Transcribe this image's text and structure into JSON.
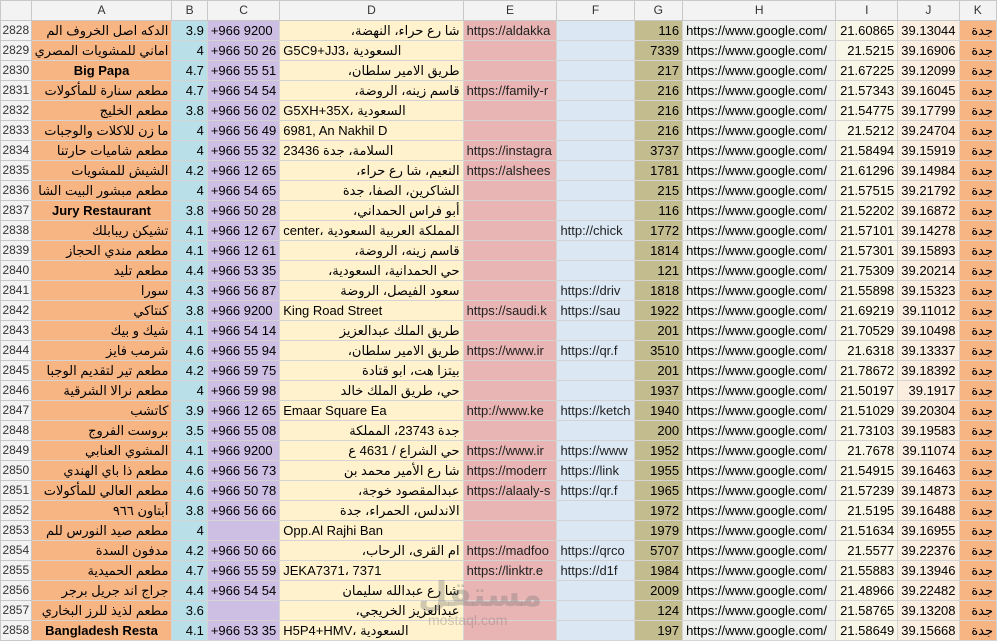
{
  "columns": [
    "A",
    "B",
    "C",
    "D",
    "E",
    "F",
    "G",
    "H",
    "I",
    "J",
    "K"
  ],
  "rows": [
    {
      "n": "2828",
      "A": "الدكه اصل الخروف الم",
      "B": "3.9",
      "C": "+966 9200",
      "D": "شا رع حراء، النهضة،",
      "E": "https://aldakka",
      "F": "",
      "G": "116",
      "H": "https://www.google.com/",
      "I": "21.60865",
      "J": "39.13044",
      "K": "جدة"
    },
    {
      "n": "2829",
      "A": "اماني للمشويات المصري",
      "B": "4",
      "C": "+966 50 26",
      "D": "G5C9+JJ3، السعودية",
      "E": "",
      "F": "",
      "G": "7339",
      "H": "https://www.google.com/",
      "I": "21.5215",
      "J": "39.16906",
      "K": "جدة"
    },
    {
      "n": "2830",
      "A": "Big Papa",
      "B": "4.7",
      "C": "+966 55 51",
      "D": "طريق الامير سلطان،",
      "E": "",
      "F": "",
      "G": "217",
      "H": "https://www.google.com/",
      "I": "21.67225",
      "J": "39.12099",
      "K": "جدة"
    },
    {
      "n": "2831",
      "A": "مطعم سنارة للمأكولات",
      "B": "4.7",
      "C": "+966 54 54",
      "D": "قاسم زينه، الروضة،",
      "E": "https://family-r",
      "F": "",
      "G": "216",
      "H": "https://www.google.com/",
      "I": "21.57343",
      "J": "39.16045",
      "K": "جدة"
    },
    {
      "n": "2832",
      "A": "مطعم الخليج",
      "B": "3.8",
      "C": "+966 56 02",
      "D": "G5XH+35X، السعودية",
      "E": "",
      "F": "",
      "G": "216",
      "H": "https://www.google.com/",
      "I": "21.54775",
      "J": "39.17799",
      "K": "جدة"
    },
    {
      "n": "2833",
      "A": "ما زن للاكلات والوجبات",
      "B": "4",
      "C": "+966 56 49",
      "D": "6981, An Nakhil D",
      "E": "",
      "F": "",
      "G": "216",
      "H": "https://www.google.com/",
      "I": "21.5212",
      "J": "39.24704",
      "K": "جدة"
    },
    {
      "n": "2834",
      "A": "مطعم شاميات حارتنا",
      "B": "4",
      "C": "+966 55 32",
      "D": "23436 السلامة، جدة",
      "E": "https://instagra",
      "F": "",
      "G": "3737",
      "H": "https://www.google.com/",
      "I": "21.58494",
      "J": "39.15919",
      "K": "جدة"
    },
    {
      "n": "2835",
      "A": "الشيش للمشويات",
      "B": "4.2",
      "C": "+966 12 65",
      "D": "النعيم، شا رع حراء،",
      "E": "https://alshees",
      "F": "",
      "G": "1781",
      "H": "https://www.google.com/",
      "I": "21.61296",
      "J": "39.14984",
      "K": "جدة"
    },
    {
      "n": "2836",
      "A": "مطعم مبشور البيت الشا",
      "B": "4",
      "C": "+966 54 65",
      "D": "الشاكرين، الصفا، جدة",
      "E": "",
      "F": "",
      "G": "215",
      "H": "https://www.google.com/",
      "I": "21.57515",
      "J": "39.21792",
      "K": "جدة"
    },
    {
      "n": "2837",
      "A": "Jury Restaurant",
      "B": "3.8",
      "C": "+966 50 28",
      "D": "أبو فراس الحمداني،",
      "E": "",
      "F": "",
      "G": "116",
      "H": "https://www.google.com/",
      "I": "21.52202",
      "J": "39.16872",
      "K": "جدة"
    },
    {
      "n": "2838",
      "A": "تشيكن ريبابلك",
      "B": "4.1",
      "C": "+966 12 67",
      "D": "center، المملكة العربية السعودية",
      "E": "",
      "F": "http://chick",
      "G": "1772",
      "H": "https://www.google.com/",
      "I": "21.57101",
      "J": "39.14278",
      "K": "جدة"
    },
    {
      "n": "2839",
      "A": "مطعم مندي الحجاز",
      "B": "4.1",
      "C": "+966 12 61",
      "D": "قاسم زينه، الروضة،",
      "E": "",
      "F": "",
      "G": "1814",
      "H": "https://www.google.com/",
      "I": "21.57301",
      "J": "39.15893",
      "K": "جدة"
    },
    {
      "n": "2840",
      "A": "مطعم تليد",
      "B": "4.4",
      "C": "+966 53 35",
      "D": "حي الحمدانية، السعودية،",
      "E": "",
      "F": "",
      "G": "121",
      "H": "https://www.google.com/",
      "I": "21.75309",
      "J": "39.20214",
      "K": "جدة"
    },
    {
      "n": "2841",
      "A": "سورا",
      "B": "4.3",
      "C": "+966 56 87",
      "D": "سعود الفيصل، الروضة",
      "E": "",
      "F": "https://driv",
      "G": "1818",
      "H": "https://www.google.com/",
      "I": "21.55898",
      "J": "39.15323",
      "K": "جدة"
    },
    {
      "n": "2842",
      "A": "كنتاكي",
      "B": "3.8",
      "C": "+966 9200",
      "D": "King Road Street",
      "E": "https://saudi.k",
      "F": "https://sau",
      "G": "1922",
      "H": "https://www.google.com/",
      "I": "21.69219",
      "J": "39.11012",
      "K": "جدة"
    },
    {
      "n": "2843",
      "A": "شيك و بيك",
      "B": "4.1",
      "C": "+966 54 14",
      "D": "طريق الملك عبدالعزيز",
      "E": "",
      "F": "",
      "G": "201",
      "H": "https://www.google.com/",
      "I": "21.70529",
      "J": "39.10498",
      "K": "جدة"
    },
    {
      "n": "2844",
      "A": "شرمب فايز",
      "B": "4.6",
      "C": "+966 55 94",
      "D": "طريق الامير سلطان،",
      "E": "https://www.ir",
      "F": "https://qr.f",
      "G": "3510",
      "H": "https://www.google.com/",
      "I": "21.6318",
      "J": "39.13337",
      "K": "جدة"
    },
    {
      "n": "2845",
      "A": "مطعم تير لتقديم الوجبا",
      "B": "4.2",
      "C": "+966 59 75",
      "D": "بيتزا هت، ابو قتادة",
      "E": "",
      "F": "",
      "G": "201",
      "H": "https://www.google.com/",
      "I": "21.78672",
      "J": "39.18392",
      "K": "جدة"
    },
    {
      "n": "2846",
      "A": "مطعم نرالا الشرقية",
      "B": "4",
      "C": "+966 59 98",
      "D": "حي، طريق الملك خالد",
      "E": "",
      "F": "",
      "G": "1937",
      "H": "https://www.google.com/",
      "I": "21.50197",
      "J": "39.1917",
      "K": "جدة"
    },
    {
      "n": "2847",
      "A": "كاتشب",
      "B": "3.9",
      "C": "+966 12 65",
      "D": "Emaar Square Ea",
      "E": "http://www.ke",
      "F": "https://ketch",
      "G": "1940",
      "H": "https://www.google.com/",
      "I": "21.51029",
      "J": "39.20304",
      "K": "جدة"
    },
    {
      "n": "2848",
      "A": "بروست الفروج",
      "B": "3.5",
      "C": "+966 55 08",
      "D": "جدة 23743، المملكة",
      "E": "",
      "F": "",
      "G": "200",
      "H": "https://www.google.com/",
      "I": "21.73103",
      "J": "39.19583",
      "K": "جدة"
    },
    {
      "n": "2849",
      "A": "المشوي العنابي",
      "B": "4.1",
      "C": "+966 9200",
      "D": "حي الشراع / 4631 ع",
      "E": "https://www.ir",
      "F": "https://www",
      "G": "1952",
      "H": "https://www.google.com/",
      "I": "21.7678",
      "J": "39.11074",
      "K": "جدة"
    },
    {
      "n": "2850",
      "A": "مطعم ذا باي الهندي",
      "B": "4.6",
      "C": "+966 56 73",
      "D": "شا رع الأمير محمد بن",
      "E": "https://moderr",
      "F": "https://link",
      "G": "1955",
      "H": "https://www.google.com/",
      "I": "21.54915",
      "J": "39.16463",
      "K": "جدة"
    },
    {
      "n": "2851",
      "A": "مطعم العالي للمأكولات",
      "B": "4.6",
      "C": "+966 50 78",
      "D": "عبدالمقصود خوجة،",
      "E": "https://alaaly-s",
      "F": "https://qr.f",
      "G": "1965",
      "H": "https://www.google.com/",
      "I": "21.57239",
      "J": "39.14873",
      "K": "جدة"
    },
    {
      "n": "2852",
      "A": "أبتاون ٩٦٦",
      "B": "3.8",
      "C": "+966 56 66",
      "D": "الاندلس، الحمراء، جدة",
      "E": "",
      "F": "",
      "G": "1972",
      "H": "https://www.google.com/",
      "I": "21.5195",
      "J": "39.16488",
      "K": "جدة"
    },
    {
      "n": "2853",
      "A": "مطعم صيد النورس للم",
      "B": "4",
      "C": "",
      "D": "Opp.Al Rajhi Ban",
      "E": "",
      "F": "",
      "G": "1979",
      "H": "https://www.google.com/",
      "I": "21.51634",
      "J": "39.16955",
      "K": "جدة"
    },
    {
      "n": "2854",
      "A": "مدفون السدة",
      "B": "4.2",
      "C": "+966 50 66",
      "D": "ام القرى، الرحاب،",
      "E": "https://madfoo",
      "F": "https://qrco",
      "G": "5707",
      "H": "https://www.google.com/",
      "I": "21.5577",
      "J": "39.22376",
      "K": "جدة"
    },
    {
      "n": "2855",
      "A": "مطعم الحميدية",
      "B": "4.7",
      "C": "+966 55 59",
      "D": "JEKA7371، 7371",
      "E": "https://linktr.e",
      "F": "https://d1f",
      "G": "1984",
      "H": "https://www.google.com/",
      "I": "21.55883",
      "J": "39.13946",
      "K": "جدة"
    },
    {
      "n": "2856",
      "A": "جراج اند جريل برجر",
      "B": "4.4",
      "C": "+966 54 54",
      "D": "شا رع عبدالله سليمان",
      "E": "",
      "F": "",
      "G": "2009",
      "H": "https://www.google.com/",
      "I": "21.48966",
      "J": "39.22482",
      "K": "جدة"
    },
    {
      "n": "2857",
      "A": "مطعم لذيذ للرز البخاري",
      "B": "3.6",
      "C": "",
      "D": "عبدالعزيز الخريجي،",
      "E": "",
      "F": "",
      "G": "124",
      "H": "https://www.google.com/",
      "I": "21.58765",
      "J": "39.13208",
      "K": "جدة"
    },
    {
      "n": "2858",
      "A": "Bangladesh Resta",
      "B": "4.1",
      "C": "+966 53 35",
      "D": "H5P4+HMV، السعودية",
      "E": "",
      "F": "",
      "G": "197",
      "H": "https://www.google.com/",
      "I": "21.58649",
      "J": "39.15668",
      "K": "جدة"
    }
  ],
  "watermark": {
    "logo": "مستقل",
    "site": "mostaql.com"
  }
}
